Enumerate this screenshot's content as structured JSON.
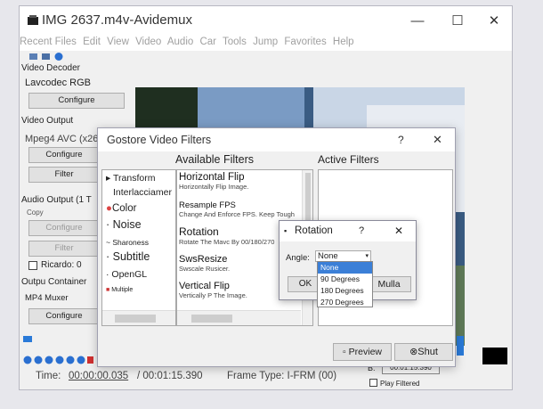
{
  "window": {
    "title": "IMG 2637.m4v-Avidemux",
    "minimize": "—",
    "maximize": "☐",
    "close": "✕"
  },
  "menu": [
    "Recent Files",
    "Edit",
    "View",
    "Video",
    "Audio",
    "Car",
    "Tools",
    "Jump",
    "Favorites",
    "Help"
  ],
  "left_panel": {
    "video_decoder_label": "Video Decoder",
    "decoder_value": "Lavcodec RGB",
    "configure": "Configure",
    "video_output_label": "Video Output",
    "video_output_value": "Mpeg4 AVC (x264",
    "configure2": "Configure",
    "filter": "Filter",
    "audio_output_label": "Audio Output (1 T",
    "audio_copy": "Copy",
    "configure3": "Configure",
    "filter2": "Filter",
    "shift_checkbox": "Ricardo: 0",
    "output_container_label": "Outpu Container",
    "container_value": "MP4 Muxer",
    "configure4": "Configure"
  },
  "status_bar": {
    "time_label": "Time:",
    "time": "00:00:00.035",
    "total": "/ 00:01:15.390",
    "frame_type": "Frame Type: I-FRM (00)",
    "b_label": "B:",
    "b_value": "00:01:15.390",
    "play_filtered": "Play Filtered"
  },
  "filter_dialog": {
    "title": "Gostore Video Filters",
    "help": "?",
    "close": "✕",
    "available_title": "Available Filters",
    "active_title": "Active Filters",
    "categories": [
      "Transform",
      "Interlacciamer",
      "Color",
      "Noise",
      "Sharoness",
      "Subtitle",
      "OpenGL",
      "Multiple"
    ],
    "filters": [
      {
        "name": "Horizontal Flip",
        "desc": "Horizontally Flip Image."
      },
      {
        "name": "Resample FPS",
        "desc": "Change And Enforce FPS. Keep Tough"
      },
      {
        "name": "Rotation",
        "desc": "Rotate The Mavc By 00/180/270"
      },
      {
        "name": "SwsResize",
        "desc": "Swscale Rusicer."
      },
      {
        "name": "Vertical Flip",
        "desc": "Vertically P The Image."
      }
    ],
    "preview": "Preview",
    "shut": "Shut"
  },
  "rotation_dialog": {
    "title": "Rotation",
    "help": "?",
    "close": "✕",
    "angle_label": "Angle:",
    "angle_value": "None",
    "ok": "OK",
    "cancel": "Mulla",
    "options": [
      "None",
      "90 Degrees",
      "180 Degrees",
      "270 Degrees"
    ],
    "selected_index": 0
  },
  "colors": {
    "selection": "#3b7fd7",
    "video_bg": "#3a5c83",
    "black_box": "#000000",
    "titlebar": "#ffffff"
  }
}
